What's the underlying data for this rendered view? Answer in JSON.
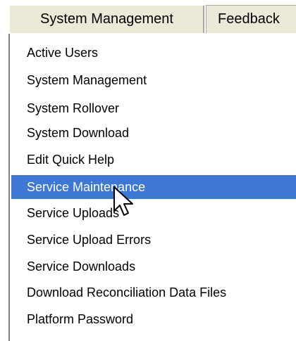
{
  "menubar": {
    "tabs": [
      {
        "label": "System Management"
      },
      {
        "label": "Feedback"
      }
    ]
  },
  "dropdown": {
    "items": [
      {
        "label": "Active Users"
      },
      {
        "label": "System Management"
      },
      {
        "label": "System Rollover"
      },
      {
        "label": "System Download"
      },
      {
        "label": "Edit Quick Help"
      },
      {
        "label": "Service Maintenance",
        "selected": true
      },
      {
        "label": "Service Uploads"
      },
      {
        "label": "Service Upload Errors"
      },
      {
        "label": "Service Downloads"
      },
      {
        "label": "Download Reconciliation Data Files"
      },
      {
        "label": "Platform Password"
      }
    ],
    "selected_color": "#3d78d4"
  }
}
